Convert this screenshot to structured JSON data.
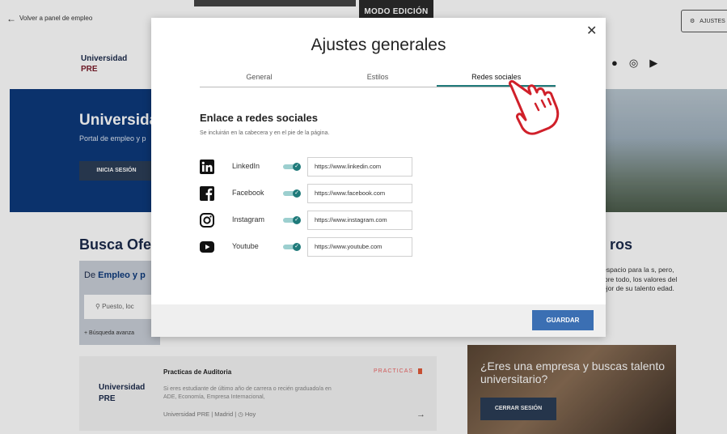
{
  "background": {
    "edit_badge": "MODO EDICIÓN",
    "back_link": "Volver a panel de empleo",
    "ajustes_button": "AJUSTES",
    "logo_line1": "Universidad",
    "logo_line2": "PRE",
    "hero_title": "Universida",
    "hero_subtitle": "Portal de empleo y p",
    "hero_button": "INICIA SESIÓN",
    "busca_title": "Busca Ofe",
    "search_prefix": "De",
    "search_prefix_bold": "Empleo y p",
    "search_placeholder": "Puesto, loc",
    "advanced_search": "+ Búsqueda avanza",
    "right_title": "ros",
    "right_text": "n espacio para la s, pero, sobre todo, los valores del mejor de su talento edad.",
    "job": {
      "title": "Practicas de Auditoria",
      "description": "Si eres estudiante de último año de carrera o recién graduado/a en ADE, Economía, Empresa Internacional,",
      "meta": "Universidad PRE   |   Madrid   |   ◷ Hoy",
      "badge": "PRACTICAS",
      "logo_line1": "Universidad",
      "logo_line2": "PRE"
    },
    "promo_title": "¿Eres una empresa y buscas talento universitario?",
    "promo_button": "CERRAR SESIÓN"
  },
  "modal": {
    "title": "Ajustes generales",
    "close": "✕",
    "tabs": [
      {
        "label": "General",
        "active": false
      },
      {
        "label": "Estilos",
        "active": false
      },
      {
        "label": "Redes sociales",
        "active": true
      }
    ],
    "section_title": "Enlace a redes sociales",
    "section_subtitle": "Se incluirán en la cabecera y en el pie de la página.",
    "networks": [
      {
        "icon": "linkedin-icon",
        "name": "LinkedIn",
        "enabled": true,
        "url": "https://www.linkedin.com"
      },
      {
        "icon": "facebook-icon",
        "name": "Facebook",
        "enabled": true,
        "url": "https://www.facebook.com"
      },
      {
        "icon": "instagram-icon",
        "name": "Instagram",
        "enabled": true,
        "url": "https://www.instagram.com"
      },
      {
        "icon": "youtube-icon",
        "name": "Youtube",
        "enabled": true,
        "url": "https://www.youtube.com"
      }
    ],
    "save_button": "GUARDAR"
  },
  "colors": {
    "accent_teal": "#1f7a7a",
    "save_blue": "#3b6fb3",
    "hero_blue": "#0d3a7c",
    "hand_red": "#d0202a"
  }
}
